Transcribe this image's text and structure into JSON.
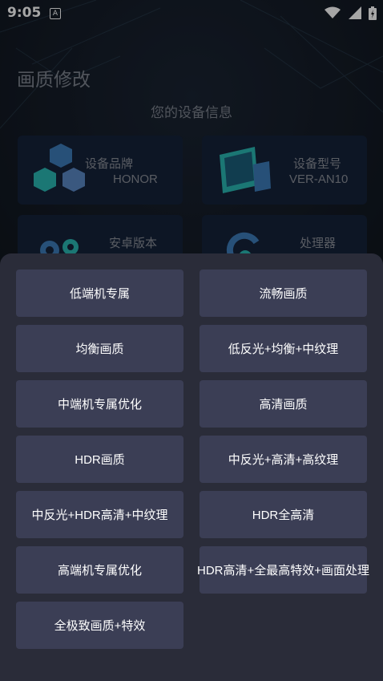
{
  "status_bar": {
    "time": "9:05",
    "notification_icon": "a-icon",
    "icons": [
      "wifi-icon",
      "signal-icon",
      "battery-icon"
    ]
  },
  "page": {
    "title": "画质修改",
    "device_info_title": "您的设备信息"
  },
  "device_cards": [
    {
      "label": "设备品牌",
      "value": "HONOR",
      "icon": "cubes-icon"
    },
    {
      "label": "设备型号",
      "value": "VER-AN10",
      "icon": "devices-icon"
    },
    {
      "label": "安卓版本",
      "value": "",
      "icon": "gears-icon"
    },
    {
      "label": "处理器",
      "value": "",
      "icon": "refresh-icon"
    }
  ],
  "options": [
    "低端机专属",
    "流畅画质",
    "均衡画质",
    "低反光+均衡+中纹理",
    "中端机专属优化",
    "高清画质",
    "HDR画质",
    "中反光+高清+高纹理",
    "中反光+HDR高清+中纹理",
    "HDR全高清",
    "高端机专属优化",
    "HDR高清+全最高特效+画面处理",
    "全极致画质+特效"
  ],
  "colors": {
    "sheet_bg": "#2a2c39",
    "button_bg": "#3b3e55",
    "card_bg": "#15223a",
    "accent_teal": "#2ab7b3",
    "accent_blue": "#3d7bb8"
  }
}
